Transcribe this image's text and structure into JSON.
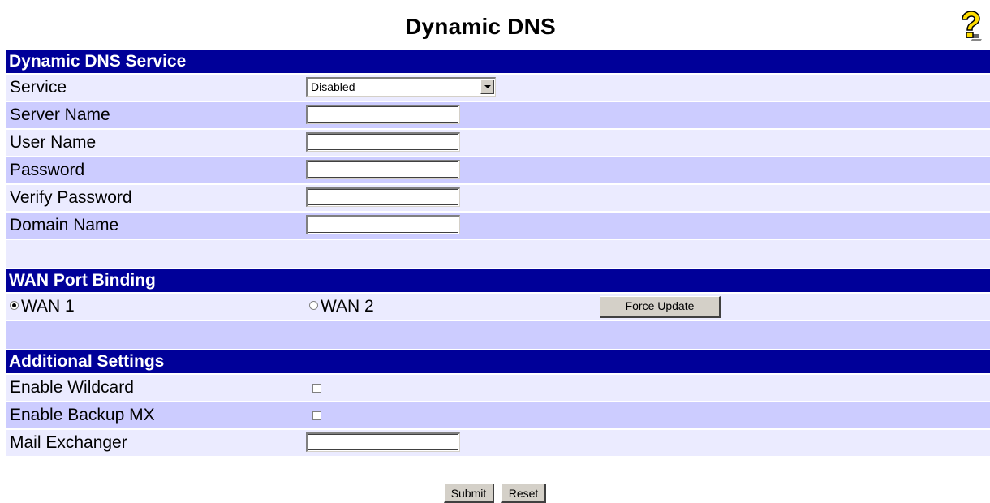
{
  "page": {
    "title": "Dynamic DNS",
    "help_icon": "help-question-icon"
  },
  "dns_service": {
    "header": "Dynamic DNS Service",
    "service": {
      "label": "Service",
      "value": "Disabled"
    },
    "server_name": {
      "label": "Server Name",
      "value": ""
    },
    "user_name": {
      "label": "User Name",
      "value": ""
    },
    "password": {
      "label": "Password",
      "value": ""
    },
    "verify_password": {
      "label": "Verify Password",
      "value": ""
    },
    "domain_name": {
      "label": "Domain Name",
      "value": ""
    }
  },
  "wan_binding": {
    "header": "WAN Port Binding",
    "wan1": {
      "label": "WAN 1",
      "checked": true
    },
    "wan2": {
      "label": "WAN 2",
      "checked": false
    },
    "force_update_label": "Force Update"
  },
  "additional": {
    "header": "Additional Settings",
    "enable_wildcard": {
      "label": "Enable Wildcard",
      "checked": false
    },
    "enable_backup_mx": {
      "label": "Enable Backup MX",
      "checked": false
    },
    "mail_exchanger": {
      "label": "Mail Exchanger",
      "value": ""
    }
  },
  "footer": {
    "submit_label": "Submit",
    "reset_label": "Reset"
  },
  "colors": {
    "header_bg": "#000099",
    "row_dark": "#ccccff",
    "row_light": "#ebebff"
  }
}
